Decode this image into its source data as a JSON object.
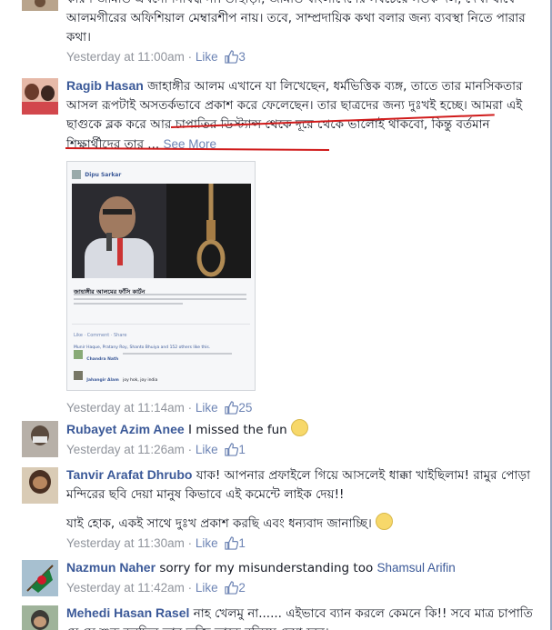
{
  "comments": [
    {
      "author": "",
      "text": "কারণ জামাত এখনো নিষিদ্ধ না। তাছাড়া, জামাত বাংলাদেশের সবচেয়ে সতর্ক দল, দেখা যাবে আলমগীরের অফিশিয়াল মেম্বারশীপ নায়। তবে, সাম্প্রদায়িক কথা বলার জন্য ব্যবস্থা নিতে পারার কথা।",
      "time": "Yesterday at 11:00am",
      "like": "Like",
      "likes": "3"
    },
    {
      "author": "Ragib Hasan",
      "text": "জাহাঙ্গীর আলম এখানে যা লিখেছেন, ধর্মভিত্তিক ব্যঙ্গ, তাতে তার মানসিকতার আসল রূপটাই অসতর্কভাবে প্রকাশ করে ফেলেছেন। তার ছাত্রদের জন্য দুঃখই হচ্ছে। আমরা এই ছাগুকে ব্লক করে আর চাপাতির ডিস্ট্যান্স থেকে দূরে থেকে ভালোই থাকবো, কিন্তু বর্তমান শিক্ষার্থীদের তার ...",
      "see_more": "See More",
      "time": "Yesterday at 11:14am",
      "like": "Like",
      "likes": "25",
      "attachment": {
        "poster": "Dipu Sarkar",
        "headline": "জাহাঙ্গীর আলমের ফাঁসি কার্টুন",
        "actions": "Like · Comment · Share",
        "liked_by": "Munir Haque, Pratany Roy, Shanto Bhuiya and 152 others like this.",
        "reply1_author": "Chandra Nath",
        "reply1_text": "",
        "reply2_author": "Jahangir Alam",
        "reply2_text": "joy hok, joy india"
      }
    },
    {
      "author": "Rubayet Azim Anee",
      "text": "I missed the fun",
      "time": "Yesterday at 11:26am",
      "like": "Like",
      "likes": "1"
    },
    {
      "author": "Tanvir Arafat Dhrubo",
      "text": "যাক! আপনার প্রফাইলে গিয়ে আসলেই ধাক্কা খাইছিলাম! রামুর পোড়া মন্দিরের ছবি দেয়া মানুষ কিভাবে এই কমেন্টে লাইক দেয়!!",
      "text2": "যাই হোক, একই সাথে দুঃখ প্রকাশ করছি এবং ধন্যবাদ জানাচ্ছি।",
      "time": "Yesterday at 11:30am",
      "like": "Like",
      "likes": "1"
    },
    {
      "author": "Nazmun Naher",
      "text": "sorry for my misunderstanding too",
      "tag": "Shamsul Arifin",
      "time": "Yesterday at 11:42am",
      "like": "Like",
      "likes": "2"
    },
    {
      "author": "Mehedi Hasan Rasel",
      "text": "নাহ খেলমু না...... এইভাবে ব্যান করলে কেমনে কি!! সবে মাত্র চাপাতি যে সে শুরু করছিল তার ভক্তি তাকে বলিয়ে দেয়া হবে।"
    }
  ],
  "colors": {
    "link": "#3b5998",
    "meta": "#90949c",
    "like_blue": "#6d84b4",
    "highlight_underline": "#d01a1a"
  }
}
